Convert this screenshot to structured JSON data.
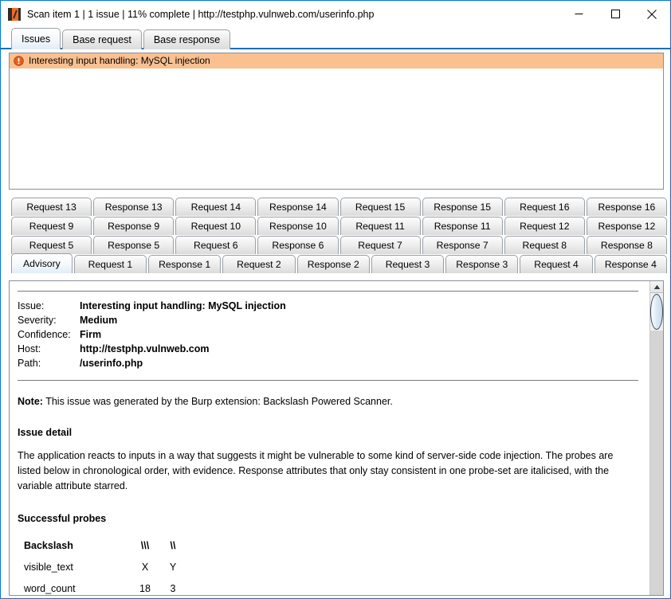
{
  "window": {
    "title": "Scan item 1 | 1 issue | 11% complete | http://testphp.vulnweb.com/userinfo.php",
    "app_icon": "burp-suite-icon",
    "controls": {
      "minimize": "minimize-icon",
      "maximize": "maximize-icon",
      "close": "close-icon"
    },
    "accent_color": "#0078d7"
  },
  "top_tabs": [
    {
      "label": "Issues",
      "selected": true
    },
    {
      "label": "Base request",
      "selected": false
    },
    {
      "label": "Base response",
      "selected": false
    }
  ],
  "issues_list": {
    "rows": [
      {
        "icon": "warning-exclamation-icon",
        "label": "Interesting input handling: MySQL injection",
        "selected": true,
        "highlight_color": "#fac090"
      }
    ]
  },
  "tab_grid": {
    "rows": [
      [
        {
          "label": "Request 13",
          "selected": false
        },
        {
          "label": "Response 13",
          "selected": false
        },
        {
          "label": "Request 14",
          "selected": false
        },
        {
          "label": "Response 14",
          "selected": false
        },
        {
          "label": "Request 15",
          "selected": false
        },
        {
          "label": "Response 15",
          "selected": false
        },
        {
          "label": "Request 16",
          "selected": false
        },
        {
          "label": "Response 16",
          "selected": false
        }
      ],
      [
        {
          "label": "Request 9",
          "selected": false
        },
        {
          "label": "Response 9",
          "selected": false
        },
        {
          "label": "Request 10",
          "selected": false
        },
        {
          "label": "Response 10",
          "selected": false
        },
        {
          "label": "Request 11",
          "selected": false
        },
        {
          "label": "Response 11",
          "selected": false
        },
        {
          "label": "Request 12",
          "selected": false
        },
        {
          "label": "Response 12",
          "selected": false
        }
      ],
      [
        {
          "label": "Request 5",
          "selected": false
        },
        {
          "label": "Response 5",
          "selected": false
        },
        {
          "label": "Request 6",
          "selected": false
        },
        {
          "label": "Response 6",
          "selected": false
        },
        {
          "label": "Request 7",
          "selected": false
        },
        {
          "label": "Response 7",
          "selected": false
        },
        {
          "label": "Request 8",
          "selected": false
        },
        {
          "label": "Response 8",
          "selected": false
        }
      ],
      [
        {
          "label": "Advisory",
          "selected": true
        },
        {
          "label": "Request 1",
          "selected": false
        },
        {
          "label": "Response 1",
          "selected": false
        },
        {
          "label": "Request 2",
          "selected": false
        },
        {
          "label": "Response 2",
          "selected": false
        },
        {
          "label": "Request 3",
          "selected": false
        },
        {
          "label": "Response 3",
          "selected": false
        },
        {
          "label": "Request 4",
          "selected": false
        },
        {
          "label": "Response 4",
          "selected": false
        }
      ]
    ]
  },
  "advisory": {
    "meta": [
      {
        "key": "Issue:",
        "value": "Interesting input handling: MySQL injection"
      },
      {
        "key": "Severity:",
        "value": "Medium"
      },
      {
        "key": "Confidence:",
        "value": "Firm"
      },
      {
        "key": "Host:",
        "value": "http://testphp.vulnweb.com"
      },
      {
        "key": "Path:",
        "value": "/userinfo.php"
      }
    ],
    "note_label": "Note:",
    "note_text": " This issue was generated by the Burp extension: Backslash Powered Scanner.",
    "issue_detail_heading": "Issue detail",
    "issue_detail_text": "The application reacts to inputs in a way that suggests it might be vulnerable to some kind of server-side code injection. The probes are listed below in chronological order, with evidence. Response attributes that only stay consistent in one probe-set are italicised, with the variable attribute starred.",
    "probes_heading": "Successful probes",
    "probes_table": {
      "header": {
        "name": "Backslash",
        "col1": "\\\\\\",
        "col2": "\\\\"
      },
      "rows": [
        {
          "name": "visible_text",
          "col1": "X",
          "col2": "Y"
        },
        {
          "name": "word_count",
          "col1": "18",
          "col2": "3"
        }
      ]
    },
    "scrollbar": {
      "up_arrow": "scroll-up-arrow-icon"
    }
  }
}
